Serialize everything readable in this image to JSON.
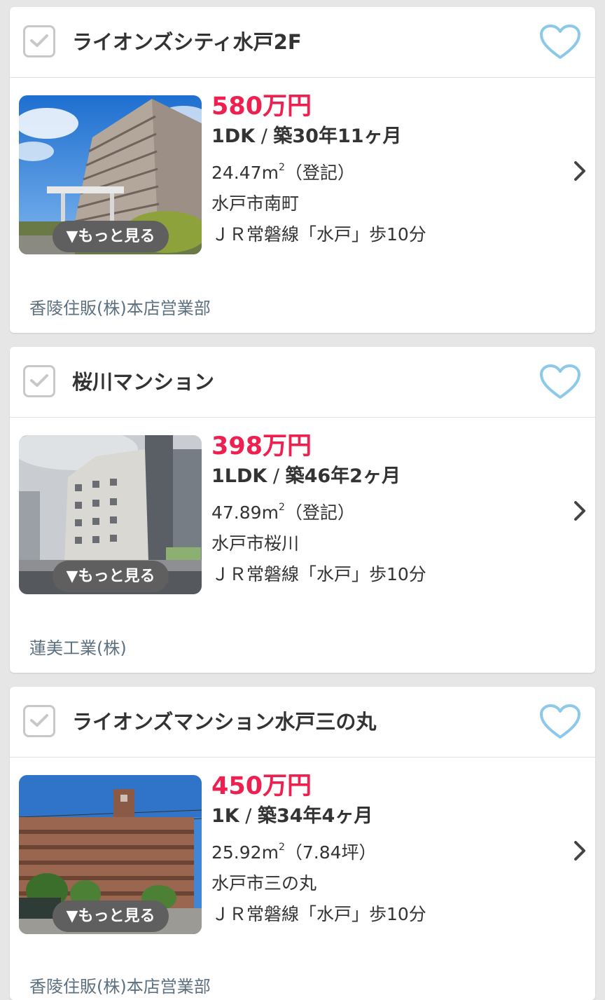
{
  "listings": [
    {
      "title": "ライオンズシティ水戸2F",
      "price": "580万円",
      "layout": "1DK",
      "separator": " / ",
      "age": "築30年11ヶ月",
      "area_value": "24.47m",
      "area_sup": "2",
      "area_note": "（登記）",
      "address": "水戸市南町",
      "station": "ＪＲ常磐線「水戸」歩10分",
      "more_label": "▼もっと見る",
      "agency": "香陵住販(株)本店営業部"
    },
    {
      "title": "桜川マンション",
      "price": "398万円",
      "layout": "1LDK",
      "separator": " / ",
      "age": "築46年2ヶ月",
      "area_value": "47.89m",
      "area_sup": "2",
      "area_note": "（登記）",
      "address": "水戸市桜川",
      "station": "ＪＲ常磐線「水戸」歩10分",
      "more_label": "▼もっと見る",
      "agency": "蓮美工業(株)"
    },
    {
      "title": "ライオンズマンション水戸三の丸",
      "price": "450万円",
      "layout": "1K",
      "separator": " / ",
      "age": "築34年4ヶ月",
      "area_value": "25.92m",
      "area_sup": "2",
      "area_note": "（7.84坪）",
      "address": "水戸市三の丸",
      "station": "ＪＲ常磐線「水戸」歩10分",
      "more_label": "▼もっと見る",
      "agency": "香陵住販(株)本店営業部"
    }
  ],
  "colors": {
    "price": "#ee2050",
    "heart": "#8cc8ea",
    "agency": "#5c7080",
    "more_button_bg": "#5f5f5f"
  },
  "icons": {
    "checkbox": "checkbox-check-icon",
    "favorite": "heart-outline-icon",
    "detail": "chevron-right-icon"
  }
}
